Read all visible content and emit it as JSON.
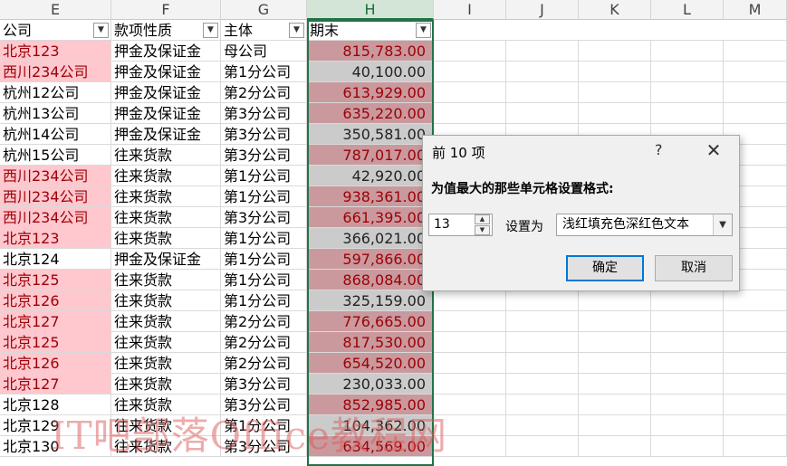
{
  "columns": [
    "E",
    "F",
    "G",
    "H",
    "I",
    "J",
    "K",
    "L",
    "M"
  ],
  "selected_column": "H",
  "headers": {
    "company": "公司",
    "nature": "款项性质",
    "entity": "主体",
    "period_end": "期末"
  },
  "rows": [
    {
      "company": "北京123",
      "nature": "押金及保证金",
      "entity": "母公司",
      "amount": "815,783.00",
      "dup": true,
      "top": true
    },
    {
      "company": "西川234公司",
      "nature": "押金及保证金",
      "entity": "第1分公司",
      "amount": "40,100.00",
      "dup": true,
      "top": false
    },
    {
      "company": "杭州12公司",
      "nature": "押金及保证金",
      "entity": "第2分公司",
      "amount": "613,929.00",
      "dup": false,
      "top": true
    },
    {
      "company": "杭州13公司",
      "nature": "押金及保证金",
      "entity": "第3分公司",
      "amount": "635,220.00",
      "dup": false,
      "top": true
    },
    {
      "company": "杭州14公司",
      "nature": "押金及保证金",
      "entity": "第3分公司",
      "amount": "350,581.00",
      "dup": false,
      "top": false
    },
    {
      "company": "杭州15公司",
      "nature": "往来货款",
      "entity": "第3分公司",
      "amount": "787,017.00",
      "dup": false,
      "top": true
    },
    {
      "company": "西川234公司",
      "nature": "往来货款",
      "entity": "第1分公司",
      "amount": "42,920.00",
      "dup": true,
      "top": false
    },
    {
      "company": "西川234公司",
      "nature": "往来货款",
      "entity": "第1分公司",
      "amount": "938,361.00",
      "dup": true,
      "top": true
    },
    {
      "company": "西川234公司",
      "nature": "往来货款",
      "entity": "第3分公司",
      "amount": "661,395.00",
      "dup": true,
      "top": true
    },
    {
      "company": "北京123",
      "nature": "往来货款",
      "entity": "第1分公司",
      "amount": "366,021.00",
      "dup": true,
      "top": false
    },
    {
      "company": "北京124",
      "nature": "押金及保证金",
      "entity": "第1分公司",
      "amount": "597,866.00",
      "dup": false,
      "top": true
    },
    {
      "company": "北京125",
      "nature": "往来货款",
      "entity": "第1分公司",
      "amount": "868,084.00",
      "dup": true,
      "top": true
    },
    {
      "company": "北京126",
      "nature": "往来货款",
      "entity": "第1分公司",
      "amount": "325,159.00",
      "dup": true,
      "top": false
    },
    {
      "company": "北京127",
      "nature": "往来货款",
      "entity": "第2分公司",
      "amount": "776,665.00",
      "dup": true,
      "top": true
    },
    {
      "company": "北京125",
      "nature": "往来货款",
      "entity": "第2分公司",
      "amount": "817,530.00",
      "dup": true,
      "top": true
    },
    {
      "company": "北京126",
      "nature": "往来货款",
      "entity": "第2分公司",
      "amount": "654,520.00",
      "dup": true,
      "top": true
    },
    {
      "company": "北京127",
      "nature": "往来货款",
      "entity": "第3分公司",
      "amount": "230,033.00",
      "dup": true,
      "top": false
    },
    {
      "company": "北京128",
      "nature": "往来货款",
      "entity": "第3分公司",
      "amount": "852,985.00",
      "dup": false,
      "top": true
    },
    {
      "company": "北京129",
      "nature": "往来货款",
      "entity": "第1分公司",
      "amount": "104,362.00",
      "dup": false,
      "top": false
    },
    {
      "company": "北京130",
      "nature": "往来货款",
      "entity": "第3分公司",
      "amount": "634,569.00",
      "dup": false,
      "top": true
    }
  ],
  "dialog": {
    "title": "前 10 项",
    "help": "?",
    "close": "✕",
    "description": "为值最大的那些单元格设置格式:",
    "count": "13",
    "set_label": "设置为",
    "format_option": "浅红填充色深红色文本",
    "ok": "确定",
    "cancel": "取消"
  },
  "watermark": "IT吧部落Office教程网",
  "colors": {
    "dup_fill": "#ffc7ce",
    "dup_text": "#9c0006",
    "top_fill": "#c9999d",
    "top_text": "#9c0006",
    "other_fill": "#cbcbcb",
    "other_text": "#222222",
    "selection": "#217346"
  }
}
